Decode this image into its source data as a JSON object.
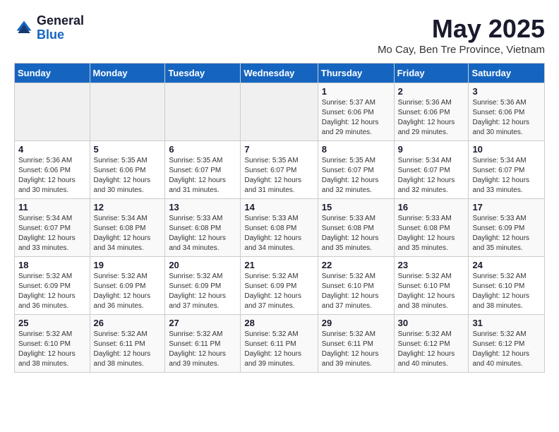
{
  "logo": {
    "general": "General",
    "blue": "Blue"
  },
  "title": {
    "month_year": "May 2025",
    "location": "Mo Cay, Ben Tre Province, Vietnam"
  },
  "days_of_week": [
    "Sunday",
    "Monday",
    "Tuesday",
    "Wednesday",
    "Thursday",
    "Friday",
    "Saturday"
  ],
  "weeks": [
    [
      {
        "day": "",
        "info": ""
      },
      {
        "day": "",
        "info": ""
      },
      {
        "day": "",
        "info": ""
      },
      {
        "day": "",
        "info": ""
      },
      {
        "day": "1",
        "info": "Sunrise: 5:37 AM\nSunset: 6:06 PM\nDaylight: 12 hours\nand 29 minutes."
      },
      {
        "day": "2",
        "info": "Sunrise: 5:36 AM\nSunset: 6:06 PM\nDaylight: 12 hours\nand 29 minutes."
      },
      {
        "day": "3",
        "info": "Sunrise: 5:36 AM\nSunset: 6:06 PM\nDaylight: 12 hours\nand 30 minutes."
      }
    ],
    [
      {
        "day": "4",
        "info": "Sunrise: 5:36 AM\nSunset: 6:06 PM\nDaylight: 12 hours\nand 30 minutes."
      },
      {
        "day": "5",
        "info": "Sunrise: 5:35 AM\nSunset: 6:06 PM\nDaylight: 12 hours\nand 30 minutes."
      },
      {
        "day": "6",
        "info": "Sunrise: 5:35 AM\nSunset: 6:07 PM\nDaylight: 12 hours\nand 31 minutes."
      },
      {
        "day": "7",
        "info": "Sunrise: 5:35 AM\nSunset: 6:07 PM\nDaylight: 12 hours\nand 31 minutes."
      },
      {
        "day": "8",
        "info": "Sunrise: 5:35 AM\nSunset: 6:07 PM\nDaylight: 12 hours\nand 32 minutes."
      },
      {
        "day": "9",
        "info": "Sunrise: 5:34 AM\nSunset: 6:07 PM\nDaylight: 12 hours\nand 32 minutes."
      },
      {
        "day": "10",
        "info": "Sunrise: 5:34 AM\nSunset: 6:07 PM\nDaylight: 12 hours\nand 33 minutes."
      }
    ],
    [
      {
        "day": "11",
        "info": "Sunrise: 5:34 AM\nSunset: 6:07 PM\nDaylight: 12 hours\nand 33 minutes."
      },
      {
        "day": "12",
        "info": "Sunrise: 5:34 AM\nSunset: 6:08 PM\nDaylight: 12 hours\nand 34 minutes."
      },
      {
        "day": "13",
        "info": "Sunrise: 5:33 AM\nSunset: 6:08 PM\nDaylight: 12 hours\nand 34 minutes."
      },
      {
        "day": "14",
        "info": "Sunrise: 5:33 AM\nSunset: 6:08 PM\nDaylight: 12 hours\nand 34 minutes."
      },
      {
        "day": "15",
        "info": "Sunrise: 5:33 AM\nSunset: 6:08 PM\nDaylight: 12 hours\nand 35 minutes."
      },
      {
        "day": "16",
        "info": "Sunrise: 5:33 AM\nSunset: 6:08 PM\nDaylight: 12 hours\nand 35 minutes."
      },
      {
        "day": "17",
        "info": "Sunrise: 5:33 AM\nSunset: 6:09 PM\nDaylight: 12 hours\nand 35 minutes."
      }
    ],
    [
      {
        "day": "18",
        "info": "Sunrise: 5:32 AM\nSunset: 6:09 PM\nDaylight: 12 hours\nand 36 minutes."
      },
      {
        "day": "19",
        "info": "Sunrise: 5:32 AM\nSunset: 6:09 PM\nDaylight: 12 hours\nand 36 minutes."
      },
      {
        "day": "20",
        "info": "Sunrise: 5:32 AM\nSunset: 6:09 PM\nDaylight: 12 hours\nand 37 minutes."
      },
      {
        "day": "21",
        "info": "Sunrise: 5:32 AM\nSunset: 6:09 PM\nDaylight: 12 hours\nand 37 minutes."
      },
      {
        "day": "22",
        "info": "Sunrise: 5:32 AM\nSunset: 6:10 PM\nDaylight: 12 hours\nand 37 minutes."
      },
      {
        "day": "23",
        "info": "Sunrise: 5:32 AM\nSunset: 6:10 PM\nDaylight: 12 hours\nand 38 minutes."
      },
      {
        "day": "24",
        "info": "Sunrise: 5:32 AM\nSunset: 6:10 PM\nDaylight: 12 hours\nand 38 minutes."
      }
    ],
    [
      {
        "day": "25",
        "info": "Sunrise: 5:32 AM\nSunset: 6:10 PM\nDaylight: 12 hours\nand 38 minutes."
      },
      {
        "day": "26",
        "info": "Sunrise: 5:32 AM\nSunset: 6:11 PM\nDaylight: 12 hours\nand 38 minutes."
      },
      {
        "day": "27",
        "info": "Sunrise: 5:32 AM\nSunset: 6:11 PM\nDaylight: 12 hours\nand 39 minutes."
      },
      {
        "day": "28",
        "info": "Sunrise: 5:32 AM\nSunset: 6:11 PM\nDaylight: 12 hours\nand 39 minutes."
      },
      {
        "day": "29",
        "info": "Sunrise: 5:32 AM\nSunset: 6:11 PM\nDaylight: 12 hours\nand 39 minutes."
      },
      {
        "day": "30",
        "info": "Sunrise: 5:32 AM\nSunset: 6:12 PM\nDaylight: 12 hours\nand 40 minutes."
      },
      {
        "day": "31",
        "info": "Sunrise: 5:32 AM\nSunset: 6:12 PM\nDaylight: 12 hours\nand 40 minutes."
      }
    ]
  ]
}
